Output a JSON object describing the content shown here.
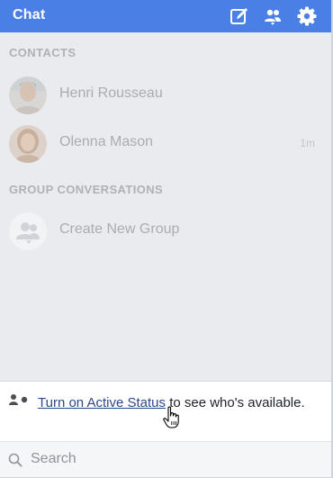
{
  "header": {
    "title": "Chat",
    "icons": [
      "compose-icon",
      "people-icon",
      "gear-icon"
    ]
  },
  "contacts": {
    "label": "CONTACTS",
    "items": [
      {
        "name": "Henri Rousseau",
        "time": ""
      },
      {
        "name": "Olenna Mason",
        "time": "1m"
      }
    ]
  },
  "groups": {
    "label": "GROUP CONVERSATIONS",
    "create_label": "Create New Group"
  },
  "status": {
    "link_text": "Turn on Active Status",
    "rest_text": " to see who's available."
  },
  "search": {
    "placeholder": "Search",
    "value": ""
  },
  "colors": {
    "header_bg": "#4a80e6",
    "list_bg": "#e9ebee",
    "link": "#2b4a8b"
  }
}
